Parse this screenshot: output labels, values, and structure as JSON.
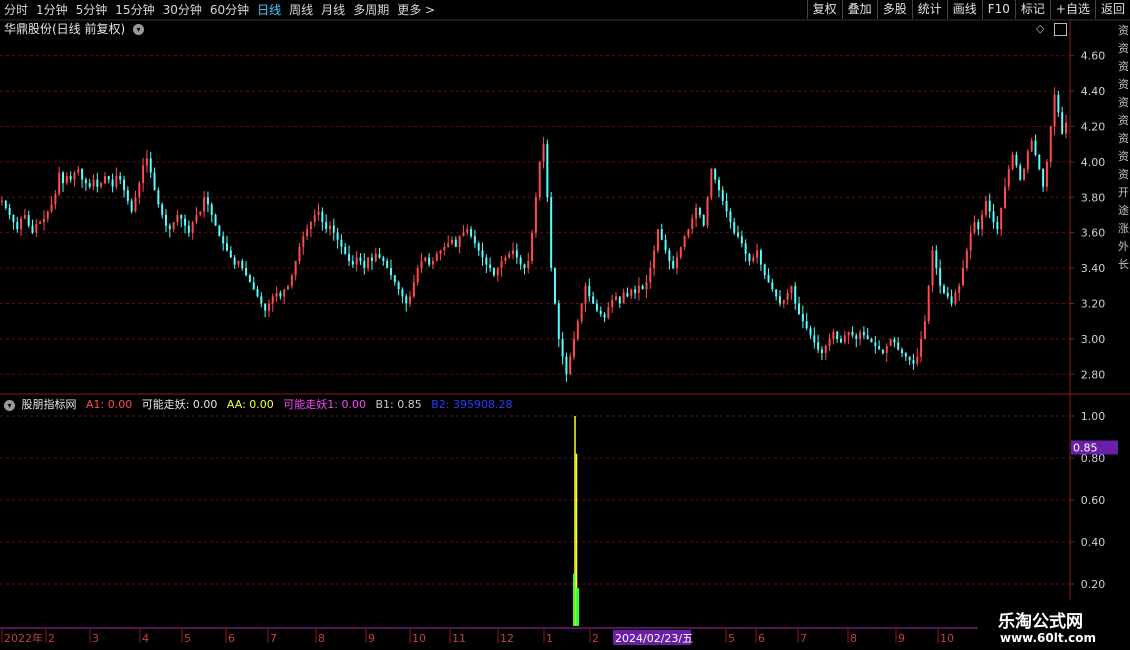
{
  "toolbar": {
    "tabs": [
      {
        "label": "分时",
        "active": false
      },
      {
        "label": "1分钟",
        "active": false
      },
      {
        "label": "5分钟",
        "active": false
      },
      {
        "label": "15分钟",
        "active": false
      },
      {
        "label": "30分钟",
        "active": false
      },
      {
        "label": "60分钟",
        "active": false
      },
      {
        "label": "日线",
        "active": true
      },
      {
        "label": "周线",
        "active": false
      },
      {
        "label": "月线",
        "active": false
      },
      {
        "label": "多周期",
        "active": false
      },
      {
        "label": "更多 >",
        "active": false
      }
    ],
    "actions": [
      "复权",
      "叠加",
      "多股",
      "统计",
      "画线",
      "F10",
      "标记",
      "+自选",
      "返回"
    ]
  },
  "main_pane": {
    "title": "华鼎股份(日线 前复权)",
    "price_axis": [
      "4.60",
      "4.40",
      "4.20",
      "4.00",
      "3.80",
      "3.60",
      "3.40",
      "3.20",
      "3.00",
      "2.80"
    ]
  },
  "indicator": {
    "name": "股朋指标网",
    "a1": "A1: 0.00",
    "kz": "可能走妖: 0.00",
    "aa": "AA: 0.00",
    "kz1": "可能走妖1: 0.00",
    "b1": "B1: 0.85",
    "b2": "B2: 395908.28",
    "axis": [
      "1.00",
      "0.80",
      "0.60",
      "0.40",
      "0.20"
    ],
    "current_label": "0.85"
  },
  "date_axis": {
    "labels": [
      "2022年",
      "2",
      "3",
      "4",
      "5",
      "6",
      "7",
      "8",
      "9",
      "10",
      "11",
      "12",
      "1",
      "2",
      "3",
      "4",
      "5",
      "6",
      "7",
      "8",
      "9",
      "10"
    ],
    "cursor_date": "2024/02/23/五"
  },
  "right_strip_text": "资资资资资资资资资开途涨外长",
  "watermark": {
    "line1": "乐淘公式网",
    "line2": "www.60lt.com"
  },
  "colors": {
    "up": "#ff4b4b",
    "down": "#54ffff",
    "grid": "#6b0a0a",
    "axis": "#8b1a1a",
    "active_tab": "#3fd3ff",
    "bar_yellow": "#ffff33",
    "bar_green": "#33ff33",
    "label_bg": "#6a1fa8"
  },
  "chart_data": {
    "type": "candlestick",
    "series_name": "华鼎股份",
    "ylim": [
      2.7,
      4.7
    ],
    "close": [
      3.78,
      3.74,
      3.7,
      3.66,
      3.62,
      3.68,
      3.7,
      3.64,
      3.6,
      3.65,
      3.66,
      3.68,
      3.72,
      3.76,
      3.82,
      3.94,
      3.88,
      3.92,
      3.9,
      3.94,
      3.96,
      3.9,
      3.88,
      3.86,
      3.9,
      3.86,
      3.88,
      3.92,
      3.9,
      3.86,
      3.92,
      3.9,
      3.84,
      3.78,
      3.72,
      3.8,
      3.88,
      3.98,
      4.02,
      3.94,
      3.84,
      3.76,
      3.7,
      3.64,
      3.62,
      3.66,
      3.7,
      3.68,
      3.64,
      3.6,
      3.66,
      3.7,
      3.72,
      3.8,
      3.76,
      3.7,
      3.64,
      3.58,
      3.54,
      3.5,
      3.46,
      3.42,
      3.44,
      3.4,
      3.36,
      3.32,
      3.28,
      3.24,
      3.2,
      3.16,
      3.2,
      3.24,
      3.26,
      3.24,
      3.28,
      3.3,
      3.36,
      3.44,
      3.52,
      3.58,
      3.62,
      3.66,
      3.7,
      3.72,
      3.66,
      3.62,
      3.64,
      3.6,
      3.56,
      3.52,
      3.48,
      3.44,
      3.42,
      3.46,
      3.44,
      3.4,
      3.46,
      3.44,
      3.48,
      3.46,
      3.44,
      3.4,
      3.36,
      3.32,
      3.28,
      3.24,
      3.2,
      3.24,
      3.32,
      3.4,
      3.44,
      3.46,
      3.42,
      3.44,
      3.48,
      3.5,
      3.52,
      3.54,
      3.56,
      3.52,
      3.58,
      3.6,
      3.62,
      3.58,
      3.54,
      3.5,
      3.46,
      3.42,
      3.4,
      3.36,
      3.4,
      3.44,
      3.46,
      3.48,
      3.5,
      3.46,
      3.42,
      3.4,
      3.44,
      3.6,
      3.8,
      4.0,
      4.1,
      3.8,
      3.4,
      3.2,
      3.0,
      2.9,
      2.8,
      2.9,
      3.0,
      3.1,
      3.2,
      3.3,
      3.24,
      3.2,
      3.16,
      3.14,
      3.12,
      3.18,
      3.22,
      3.24,
      3.2,
      3.26,
      3.24,
      3.28,
      3.26,
      3.3,
      3.28,
      3.32,
      3.4,
      3.5,
      3.62,
      3.56,
      3.5,
      3.44,
      3.4,
      3.46,
      3.52,
      3.58,
      3.62,
      3.68,
      3.74,
      3.7,
      3.64,
      3.8,
      3.96,
      3.9,
      3.84,
      3.78,
      3.72,
      3.66,
      3.6,
      3.58,
      3.54,
      3.48,
      3.44,
      3.46,
      3.5,
      3.42,
      3.36,
      3.32,
      3.28,
      3.24,
      3.2,
      3.22,
      3.26,
      3.3,
      3.2,
      3.14,
      3.1,
      3.06,
      3.02,
      2.98,
      2.94,
      2.92,
      2.96,
      3.0,
      3.04,
      3.0,
      2.98,
      3.02,
      3.04,
      3.02,
      3.0,
      3.04,
      3.02,
      3.0,
      2.98,
      2.96,
      2.94,
      2.92,
      2.96,
      3.0,
      2.98,
      2.94,
      2.92,
      2.9,
      2.88,
      2.86,
      2.9,
      3.0,
      3.1,
      3.3,
      3.5,
      3.4,
      3.3,
      3.26,
      3.24,
      3.2,
      3.26,
      3.3,
      3.4,
      3.5,
      3.6,
      3.66,
      3.62,
      3.7,
      3.78,
      3.72,
      3.66,
      3.62,
      3.74,
      3.86,
      3.96,
      4.04,
      3.98,
      3.9,
      3.96,
      4.06,
      4.12,
      4.04,
      3.96,
      3.86,
      4.0,
      4.2,
      4.38,
      4.28,
      4.16,
      4.22
    ]
  }
}
